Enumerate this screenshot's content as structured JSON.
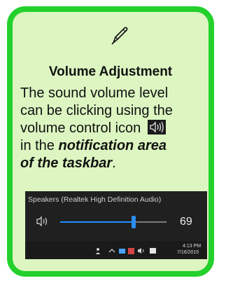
{
  "card": {
    "heading": "Volume Adjustment",
    "body": {
      "line1": "The sound volume level",
      "line2": "can be clicking using the",
      "line3": "volume control icon",
      "line4_em": "in the",
      "em1": "notification area",
      "em2": "of the taskbar",
      "end": "."
    },
    "icon": "pen-icon"
  },
  "mixer": {
    "device_label": "Speakers (Realtek High Definition Audio)",
    "volume": 69,
    "volume_text": "69",
    "taskbar": {
      "time": "4:13 PM",
      "date": "7/16/2015"
    }
  },
  "colors": {
    "card_border": "#23d02c",
    "card_fill": "#dcf5c1",
    "mixer_bg": "#202020",
    "slider_accent": "#2b8df0"
  }
}
